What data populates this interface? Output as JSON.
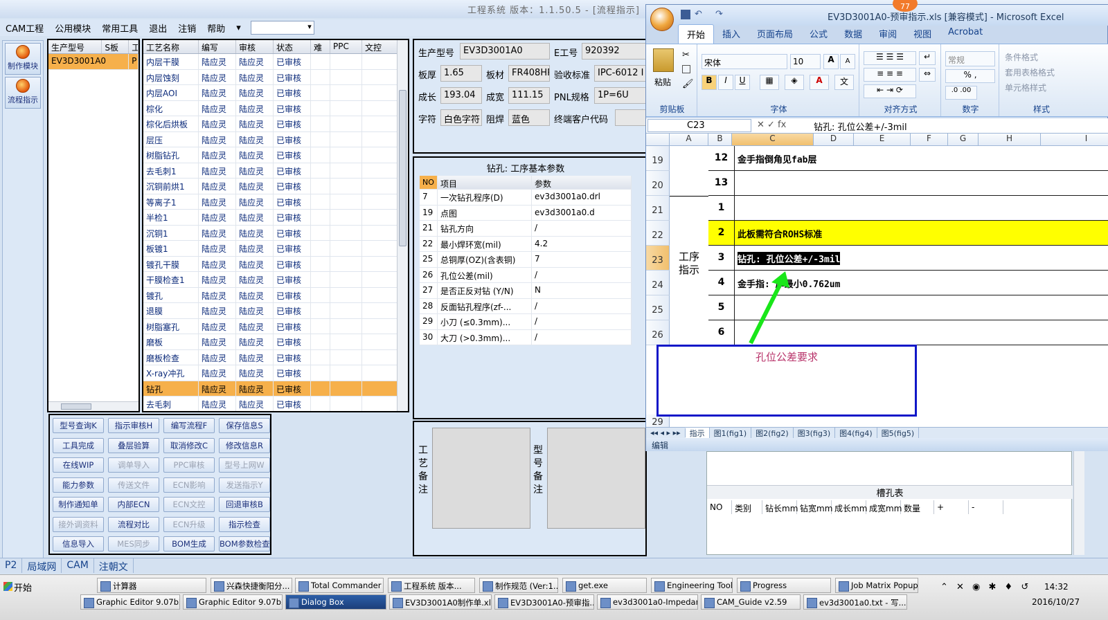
{
  "window_title": "工程系统  版本：1.1.50.5 - [流程指示]",
  "menu": [
    "CAM工程",
    "公用模块",
    "常用工具",
    "退出",
    "注销",
    "帮助"
  ],
  "menu_more": "▾",
  "leftnav": [
    "制作模块",
    "流程指示"
  ],
  "model_grid": {
    "headers": [
      "生产型号",
      "S板",
      "工"
    ],
    "rows": [
      [
        "EV3D3001A0",
        "",
        "P"
      ]
    ]
  },
  "process_grid": {
    "headers": [
      "工艺名称",
      "编写",
      "审核",
      "状态",
      "难",
      "PPC",
      "文控"
    ],
    "rows": [
      [
        "内层干膜",
        "陆应灵",
        "陆应灵",
        "已审核"
      ],
      [
        "内层蚀刻",
        "陆应灵",
        "陆应灵",
        "已审核"
      ],
      [
        "内层AOI",
        "陆应灵",
        "陆应灵",
        "已审核"
      ],
      [
        "棕化",
        "陆应灵",
        "陆应灵",
        "已审核"
      ],
      [
        "棕化后烘板",
        "陆应灵",
        "陆应灵",
        "已审核"
      ],
      [
        "层压",
        "陆应灵",
        "陆应灵",
        "已审核"
      ],
      [
        "树脂钻孔",
        "陆应灵",
        "陆应灵",
        "已审核"
      ],
      [
        "去毛刺1",
        "陆应灵",
        "陆应灵",
        "已审核"
      ],
      [
        "沉铜前烘1",
        "陆应灵",
        "陆应灵",
        "已审核"
      ],
      [
        "等离子1",
        "陆应灵",
        "陆应灵",
        "已审核"
      ],
      [
        "半检1",
        "陆应灵",
        "陆应灵",
        "已审核"
      ],
      [
        "沉铜1",
        "陆应灵",
        "陆应灵",
        "已审核"
      ],
      [
        "板镀1",
        "陆应灵",
        "陆应灵",
        "已审核"
      ],
      [
        "镀孔干膜",
        "陆应灵",
        "陆应灵",
        "已审核"
      ],
      [
        "干膜检查1",
        "陆应灵",
        "陆应灵",
        "已审核"
      ],
      [
        "镀孔",
        "陆应灵",
        "陆应灵",
        "已审核"
      ],
      [
        "退膜",
        "陆应灵",
        "陆应灵",
        "已审核"
      ],
      [
        "树脂塞孔",
        "陆应灵",
        "陆应灵",
        "已审核"
      ],
      [
        "磨板",
        "陆应灵",
        "陆应灵",
        "已审核"
      ],
      [
        "磨板检查",
        "陆应灵",
        "陆应灵",
        "已审核"
      ],
      [
        "X-ray冲孔",
        "陆应灵",
        "陆应灵",
        "已审核"
      ],
      [
        "钻孔",
        "陆应灵",
        "陆应灵",
        "已审核"
      ],
      [
        "去毛刺",
        "陆应灵",
        "陆应灵",
        "已审核"
      ]
    ],
    "selected_index": 21
  },
  "buttons": [
    {
      "label": "型号查询K",
      "enabled": true
    },
    {
      "label": "指示审核H",
      "enabled": true
    },
    {
      "label": "编写流程F",
      "enabled": true
    },
    {
      "label": "保存信息S",
      "enabled": true
    },
    {
      "label": "工具完成",
      "enabled": true
    },
    {
      "label": "叠层验算",
      "enabled": true
    },
    {
      "label": "取消修改C",
      "enabled": true
    },
    {
      "label": "修改信息R",
      "enabled": true
    },
    {
      "label": "在线WIP",
      "enabled": true
    },
    {
      "label": "调单导入",
      "enabled": false
    },
    {
      "label": "PPC审核",
      "enabled": false
    },
    {
      "label": "型号上网W",
      "enabled": false
    },
    {
      "label": "能力参数",
      "enabled": true
    },
    {
      "label": "传送文件",
      "enabled": false
    },
    {
      "label": "ECN影响",
      "enabled": false
    },
    {
      "label": "发送指示Y",
      "enabled": false
    },
    {
      "label": "制作通知单",
      "enabled": true
    },
    {
      "label": "内部ECN",
      "enabled": true
    },
    {
      "label": "ECN文控",
      "enabled": false
    },
    {
      "label": "回退审核B",
      "enabled": true
    },
    {
      "label": "接外调资料",
      "enabled": false
    },
    {
      "label": "流程对比",
      "enabled": true
    },
    {
      "label": "ECN升级",
      "enabled": false
    },
    {
      "label": "指示检查",
      "enabled": true
    },
    {
      "label": "信息导入",
      "enabled": true
    },
    {
      "label": "MES同步",
      "enabled": false
    },
    {
      "label": "BOM生成",
      "enabled": true
    },
    {
      "label": "BOM参数检查",
      "enabled": true
    }
  ],
  "info": {
    "model_label": "生产型号",
    "model_value": "EV3D3001A0",
    "e_label": "E工号",
    "e_value": "920392",
    "thick_label": "板厚",
    "thick_value": "1.65",
    "mat_label": "板材",
    "mat_value": "FR408HR",
    "std_label": "验收标准",
    "std_value": "IPC-6012 I",
    "len_label": "成长",
    "len_value": "193.04",
    "wid_label": "成宽",
    "wid_value": "111.15",
    "pnl_label": "PNL规格",
    "pnl_value": "1P=6U",
    "char_label": "字符",
    "char_value": "白色字符",
    "mask_label": "阻焊",
    "mask_value": "蓝色",
    "cust_label": "终端客户代码",
    "cust_value": ""
  },
  "params": {
    "title": "钻孔: 工序基本参数",
    "headers": [
      "NO",
      "项目",
      "参数"
    ],
    "rows": [
      [
        "7",
        "一次钻孔程序(D)",
        "ev3d3001a0.drl"
      ],
      [
        "19",
        "点图",
        "ev3d3001a0.d"
      ],
      [
        "21",
        "钻孔方向",
        "/"
      ],
      [
        "22",
        "最小焊环宽(mil)",
        "4.2"
      ],
      [
        "25",
        "总铜厚(OZ)(含表铜)",
        "7"
      ],
      [
        "26",
        "孔位公差(mil)",
        "/"
      ],
      [
        "27",
        "是否正反对钻 (Y/N)",
        "N"
      ],
      [
        "28",
        "反面钻孔程序(zf-...",
        "/"
      ],
      [
        "29",
        "小刀 (≤0.3mm)...",
        "/"
      ],
      [
        "30",
        "大刀 (>0.3mm)...",
        "/"
      ]
    ]
  },
  "notes": {
    "process_label": "工艺备注",
    "model_label": "型号备注"
  },
  "slot_table": {
    "title": "槽孔表",
    "headers": [
      "NO",
      "类别",
      "钻长mm",
      "钻宽mm",
      "成长mm",
      "成宽mm",
      "数量",
      "+",
      "-"
    ]
  },
  "excel": {
    "title": "EV3D3001A0-预审指示.xls  [兼容模式] - Microsoft Excel",
    "badge": "77",
    "tabs": [
      "开始",
      "插入",
      "页面布局",
      "公式",
      "数据",
      "审阅",
      "视图",
      "Acrobat"
    ],
    "font_name": "宋体",
    "font_size": "10",
    "number_format": "常规",
    "groups": [
      "剪贴板",
      "字体",
      "对齐方式",
      "数字",
      "样式"
    ],
    "paste": "粘贴",
    "styles": [
      "条件格式",
      "套用表格格式",
      "单元格样式"
    ],
    "cell_ref": "C23",
    "formula": "钻孔: 孔位公差+/-3mil",
    "columns": [
      "A",
      "B",
      "C",
      "D",
      "E",
      "F",
      "G",
      "H",
      "I"
    ],
    "rows": [
      {
        "row": "19",
        "num": "12",
        "text": "金手指倒角见fab层",
        "highlight": false
      },
      {
        "row": "20",
        "num": "13",
        "text": "",
        "highlight": false
      },
      {
        "row": "21",
        "num": "1",
        "text": "",
        "highlight": false
      },
      {
        "row": "22",
        "num": "2",
        "text": "此板需符合ROHS标准",
        "highlight": true
      },
      {
        "row": "23",
        "num": "3",
        "text": "钻孔: 孔位公差+/-3mil",
        "highlight": false
      },
      {
        "row": "24",
        "num": "4",
        "text": "金手指:  厚最小0.762um",
        "highlight": false
      },
      {
        "row": "25",
        "num": "5",
        "text": "",
        "highlight": false
      },
      {
        "row": "26",
        "num": "6",
        "text": "",
        "highlight": false
      }
    ],
    "merged_label": "工序指示",
    "bottom_row": "29",
    "sheet_tabs": [
      "指示",
      "图1(fig1)",
      "图2(fig2)",
      "图3(fig3)",
      "图4(fig4)",
      "图5(fig5)"
    ],
    "status": "编辑",
    "annotation": "孔位公差要求",
    "selected_row": "23",
    "selected_col": "C",
    "highlight_color": "#ffff00",
    "arrow_color": "#19e619"
  },
  "bottom_tabs": [
    "P2",
    "局域网",
    "CAM",
    "注朝文"
  ],
  "taskbar": {
    "start": "开始",
    "row1": [
      "计算器",
      "兴森快捷衡阳分...",
      "Total Commander ...",
      "工程系统  版本...",
      "制作规范 (Ver:1....",
      "get.exe",
      "Engineering Toolki...",
      "Progress",
      "Job Matrix Popup"
    ],
    "row2": [
      "Graphic Editor 9.07b2 (...",
      "Graphic Editor 9.07b2 (...",
      "Dialog Box",
      "EV3D3001A0制作单.xl...",
      "EV3D3001A0-预审指...",
      "ev3d3001a0-Impedanc...",
      "CAM_Guide v2.59",
      "ev3d3001a0.txt - 写..."
    ],
    "time": "14:32",
    "date": "2016/10/27"
  }
}
